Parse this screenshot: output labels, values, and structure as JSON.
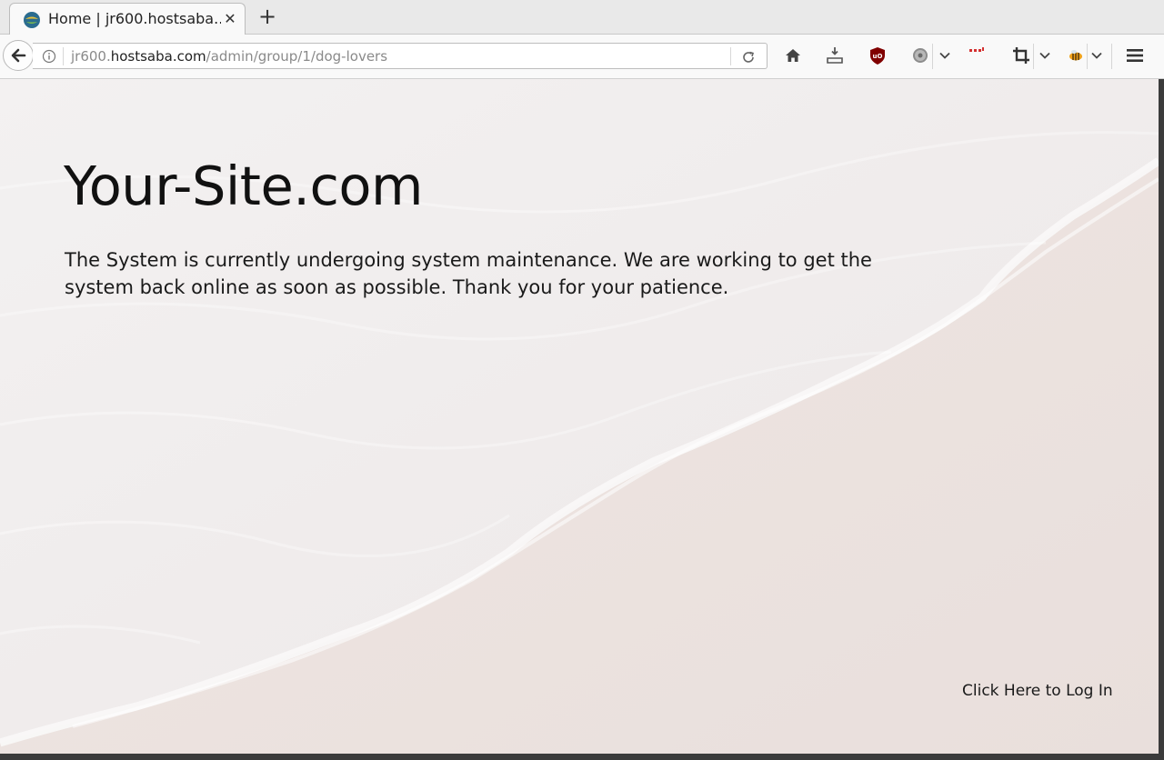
{
  "browser": {
    "tab": {
      "title": "Home | jr600.hostsaba....",
      "close_glyph": "✕"
    },
    "new_tab_glyph": "+",
    "url": {
      "subdomain": "jr600.",
      "domain": "hostsaba.com",
      "path": "/admin/group/1/dog-lovers"
    },
    "toolbar_icons": [
      "home-icon",
      "download-icon",
      "ublock-icon",
      "settings-gear-icon",
      "extension-dots-icon",
      "crop-icon",
      "bee-icon",
      "menu-icon"
    ]
  },
  "page": {
    "site_title": "Your-Site.com",
    "message": "The System is currently undergoing system maintenance. We are working to get the system back online as soon as possible. Thank you for your patience.",
    "login_link": "Click Here to Log In"
  },
  "colors": {
    "sand": "#ece5e2",
    "foam": "#f4f1f1",
    "text": "#111111"
  }
}
